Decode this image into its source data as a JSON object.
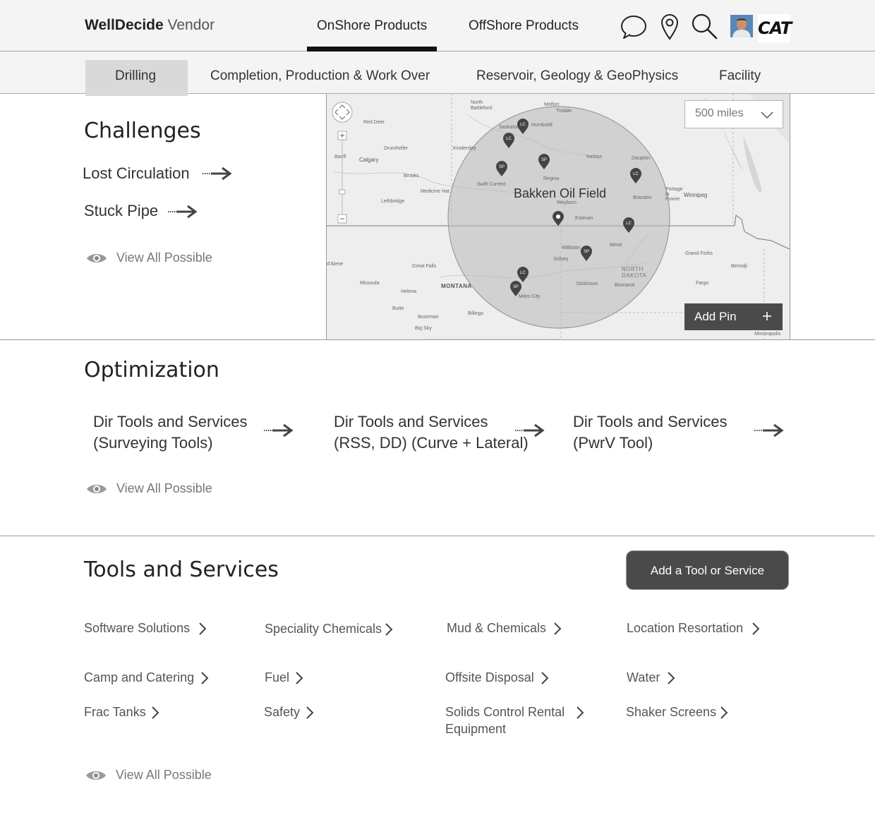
{
  "header": {
    "brand_bold": "WellDecide",
    "brand_light": "Vendor",
    "tabs": [
      {
        "label": "OnShore Products",
        "active": true
      },
      {
        "label": "OffShore Products",
        "active": false
      }
    ],
    "icons": [
      "chat-icon",
      "location-pin-icon",
      "search-icon",
      "avatar",
      "cat-logo"
    ],
    "cat_logo_text": "CAT"
  },
  "subnav": {
    "tabs": [
      {
        "label": "Drilling",
        "active": true
      },
      {
        "label": "Completion, Production & Work Over"
      },
      {
        "label": "Reservoir, Geology & GeoPhysics"
      },
      {
        "label": "Facility"
      }
    ]
  },
  "challenges": {
    "title": "Challenges",
    "items": [
      "Lost Circulation",
      "Stuck Pipe"
    ],
    "view_all": "View All Possible"
  },
  "map": {
    "radius_select": "500 miles",
    "add_pin": "Add Pin",
    "field_label": "Bakken Oil Field",
    "pins": [
      {
        "type": "LC"
      },
      {
        "type": "LC"
      },
      {
        "type": "SP"
      },
      {
        "type": "SP"
      },
      {
        "type": "LC"
      },
      {
        "type": "LC"
      },
      {
        "type": "SP"
      },
      {
        "type": "LC"
      },
      {
        "type": "SP"
      }
    ],
    "place_labels": [
      "North Battleford",
      "Melfort",
      "Red Deer",
      "Humboldt",
      "Tisdale",
      "Kindersley",
      "Saskatoon",
      "Drumheller",
      "Calgary",
      "Banff",
      "Yorkton",
      "Dauphin",
      "Brooks",
      "Swift Current",
      "Regina",
      "Medicine Hat",
      "Lethbridge",
      "Brandon",
      "Portage la Prairie",
      "Winnipeg",
      "Weyburn",
      "Estevan",
      "Minot",
      "Williston",
      "Sidney",
      "Grand Forks",
      "Great Falls",
      "Missoula",
      "Helena",
      "MONTANA",
      "NORTH DAKOTA",
      "Bemidji",
      "Fargo",
      "Dickinson",
      "Bismarck",
      "Butte",
      "Bozeman",
      "Billings",
      "Big Sky",
      "Miles City",
      "Minneapolis",
      "d'Alene"
    ]
  },
  "optimization": {
    "title": "Optimization",
    "items": [
      {
        "line1": "Dir Tools and Services",
        "line2": "(Surveying Tools)"
      },
      {
        "line1": "Dir Tools and Services",
        "line2": "(RSS, DD) (Curve + Lateral)"
      },
      {
        "line1": "Dir Tools and Services",
        "line2": "(PwrV Tool)"
      }
    ],
    "view_all": "View All Possible"
  },
  "tools": {
    "title": "Tools and Services",
    "add_button": "Add a Tool or Service",
    "items": [
      "Software Solutions",
      "Speciality Chemicals",
      "Mud & Chemicals",
      "Location Resortation",
      "Camp and Catering",
      "Fuel",
      "Offsite Disposal",
      "Water",
      "Frac Tanks",
      "Safety",
      "Solids Control Rental Equipment",
      "Shaker Screens"
    ],
    "view_all": "View All Possible"
  },
  "colors": {
    "dark_button": "#4a4a4a",
    "header_bg": "#f4f4f4",
    "active_tab_bg": "#d9d9d9",
    "underline": "#111111"
  }
}
